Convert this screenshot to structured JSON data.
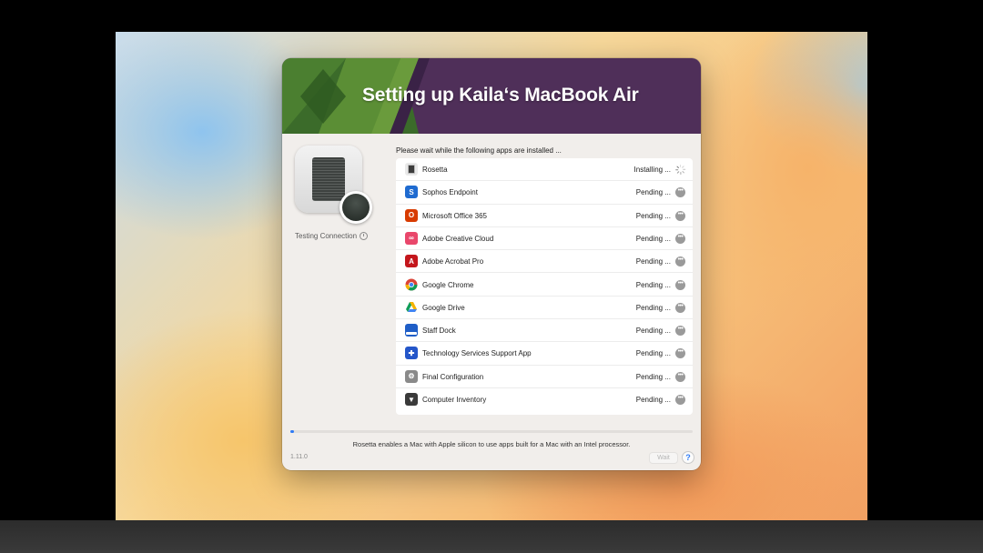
{
  "window": {
    "title": "Setting up Kaila‘s MacBook Air",
    "intro": "Please wait while the following apps are installed ...",
    "status_label": "Testing Connection",
    "message": "Rosetta enables a Mac with Apple silicon to use apps built for a Mac with an Intel processor.",
    "version": "1.11.0",
    "wait_label": "Wait",
    "help_label": "?",
    "progress_fraction": 0.01
  },
  "apps": [
    {
      "name": "Rosetta",
      "status": "Installing ...",
      "state": "installing",
      "icon": "rosetta-icon",
      "color": "#6f6f6f",
      "glyph": ""
    },
    {
      "name": "Sophos Endpoint",
      "status": "Pending ...",
      "state": "pending",
      "icon": "sophos-icon",
      "color": "#1f6bd0",
      "glyph": "S"
    },
    {
      "name": "Microsoft Office 365",
      "status": "Pending ...",
      "state": "pending",
      "icon": "office-icon",
      "color": "#d83b01",
      "glyph": "O"
    },
    {
      "name": "Adobe Creative Cloud",
      "status": "Pending ...",
      "state": "pending",
      "icon": "creative-cloud-icon",
      "color": "#e9476b",
      "glyph": "∞"
    },
    {
      "name": "Adobe Acrobat Pro",
      "status": "Pending ...",
      "state": "pending",
      "icon": "acrobat-icon",
      "color": "#c4161c",
      "glyph": "A"
    },
    {
      "name": "Google Chrome",
      "status": "Pending ...",
      "state": "pending",
      "icon": "chrome-icon",
      "color": "#ffffff",
      "glyph": ""
    },
    {
      "name": "Google Drive",
      "status": "Pending ...",
      "state": "pending",
      "icon": "drive-icon",
      "color": "#ffffff",
      "glyph": ""
    },
    {
      "name": "Staff Dock",
      "status": "Pending ...",
      "state": "pending",
      "icon": "staff-dock-icon",
      "color": "#1f5ec7",
      "glyph": ""
    },
    {
      "name": "Technology Services Support App",
      "status": "Pending ...",
      "state": "pending",
      "icon": "support-app-icon",
      "color": "#2456c9",
      "glyph": "✚"
    },
    {
      "name": "Final Configuration",
      "status": "Pending ...",
      "state": "pending",
      "icon": "settings-gear-icon",
      "color": "#8a8a8a",
      "glyph": "⚙"
    },
    {
      "name": "Computer Inventory",
      "status": "Pending ...",
      "state": "pending",
      "icon": "inventory-icon",
      "color": "#3a3a3a",
      "glyph": "▼"
    }
  ]
}
